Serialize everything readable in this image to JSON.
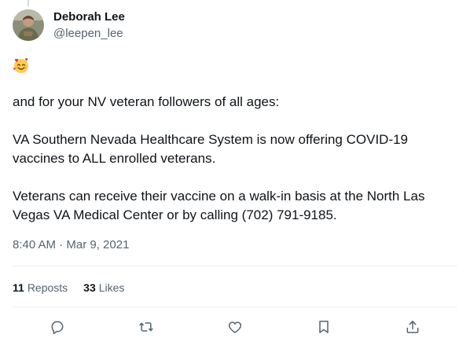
{
  "author": {
    "display_name": "Deborah Lee",
    "handle": "@leepen_lee"
  },
  "tweet": {
    "emoji_icon": "smiling-face-with-hearts-icon",
    "paragraphs": [
      "and for your NV veteran followers of all ages:",
      "VA Southern Nevada Healthcare System is now offering COVID-19 vaccines to ALL enrolled veterans.",
      "Veterans can receive their vaccine on a walk-in basis at the North Las Vegas VA Medical Center or by calling (702) 791-9185."
    ],
    "timestamp": "8:40 AM · Mar 9, 2021"
  },
  "stats": {
    "reposts_count": "11",
    "reposts_label": "Reposts",
    "likes_count": "33",
    "likes_label": "Likes"
  },
  "actions": [
    {
      "name": "reply-icon"
    },
    {
      "name": "repost-icon"
    },
    {
      "name": "like-icon"
    },
    {
      "name": "bookmark-icon"
    },
    {
      "name": "share-icon"
    }
  ],
  "colors": {
    "text_primary": "#0f1419",
    "text_secondary": "#536471",
    "divider": "#eff3f4"
  }
}
